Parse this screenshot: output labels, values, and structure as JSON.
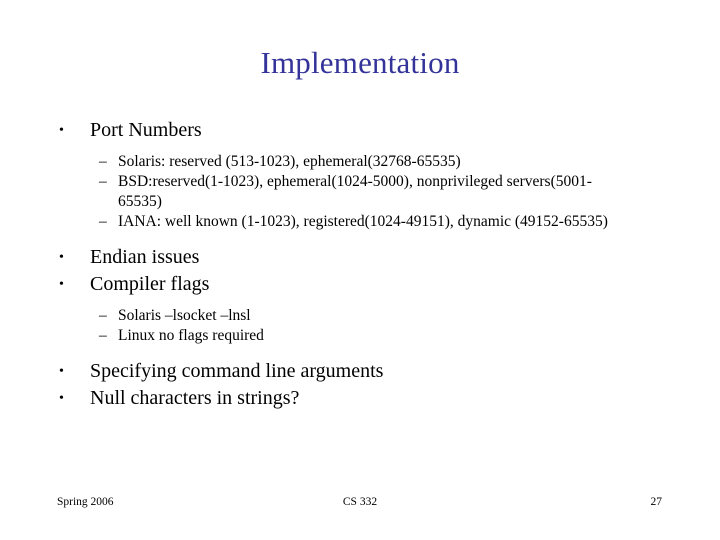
{
  "slide": {
    "title": "Implementation",
    "title_color": "#333399",
    "background_color": "#ffffff",
    "text_color": "#000000",
    "bullet_marker_level1": "•",
    "bullet_marker_level2": "–",
    "content": [
      {
        "level": 1,
        "text": "Port Numbers"
      },
      {
        "level": 2,
        "text": "Solaris: reserved (513-1023), ephemeral(32768-65535)"
      },
      {
        "level": 2,
        "text": "BSD:reserved(1-1023), ephemeral(1024-5000), nonprivileged servers(5001-65535)"
      },
      {
        "level": 2,
        "text": "IANA: well known (1-1023), registered(1024-49151), dynamic (49152-65535)"
      },
      {
        "level": 1,
        "text": "Endian issues"
      },
      {
        "level": 1,
        "text": "Compiler flags"
      },
      {
        "level": 2,
        "text": "Solaris –lsocket –lnsl"
      },
      {
        "level": 2,
        "text": "Linux no flags required"
      },
      {
        "level": 1,
        "text": "Specifying command line arguments"
      },
      {
        "level": 1,
        "text": "Null characters in strings?"
      }
    ]
  },
  "footer": {
    "left": "Spring 2006",
    "center": "CS 332",
    "page_number": "27"
  }
}
